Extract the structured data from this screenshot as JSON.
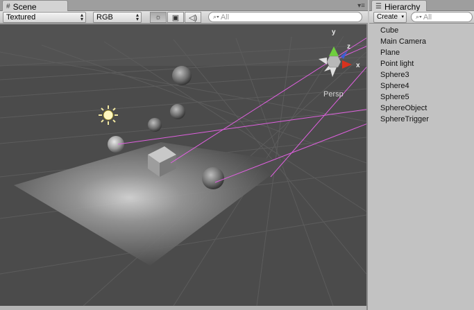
{
  "scene": {
    "tab_label": "Scene",
    "tab_icon": "grid-icon",
    "render_mode": "Textured",
    "color_mode": "RGB",
    "search_placeholder": "All",
    "persp_label": "Persp",
    "gizmo_axes": {
      "y": "y",
      "z": "z",
      "x": "x"
    },
    "colors": {
      "background": "#4b4b4b",
      "grid": "#5a5a5a",
      "link_line": "#e060e0",
      "gizmo_y": "#6fce3e",
      "gizmo_x": "#d8321e",
      "gizmo_z": "#3c5fd8"
    }
  },
  "hierarchy": {
    "tab_label": "Hierarchy",
    "create_label": "Create",
    "search_placeholder": "All",
    "items": [
      "Cube",
      "Main Camera",
      "Plane",
      "Point light",
      "Sphere3",
      "Sphere4",
      "Sphere5",
      "SphereObject",
      "SphereTrigger"
    ]
  }
}
